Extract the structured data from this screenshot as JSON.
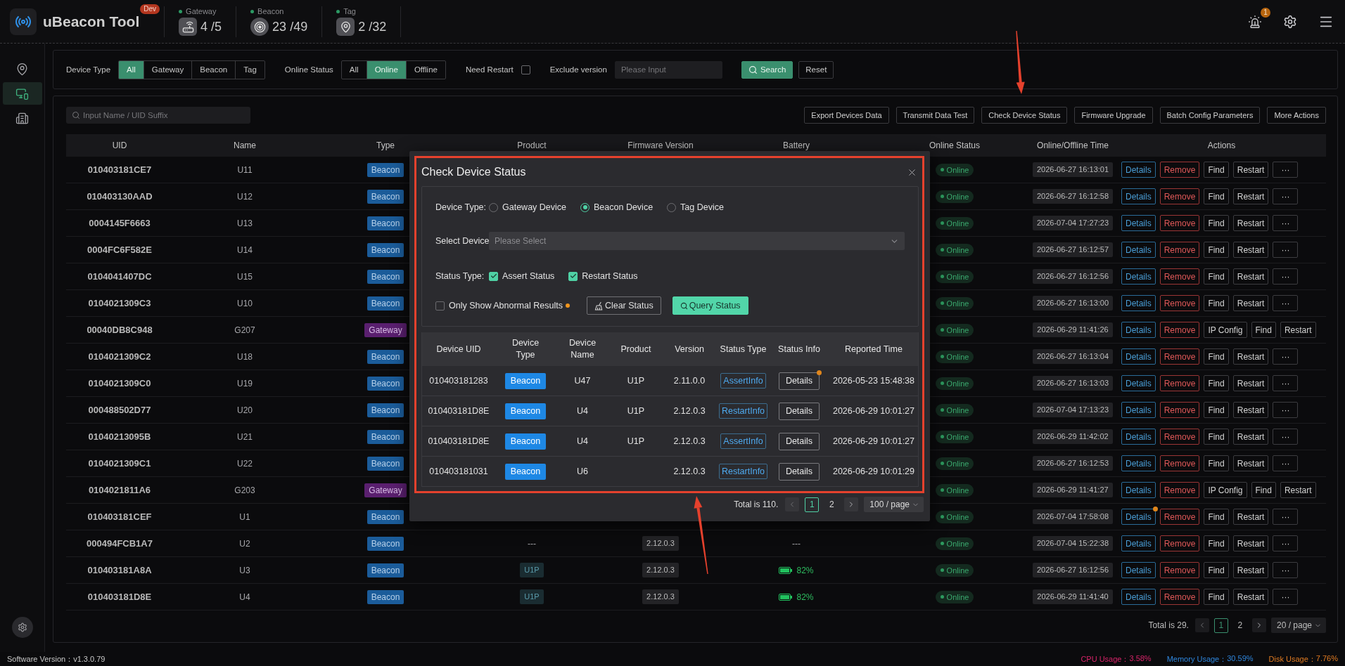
{
  "app": {
    "title": "uBeacon Tool",
    "badge": "Dev"
  },
  "stats": [
    {
      "kind": "gateway",
      "label": "Gateway",
      "value": "4 /5"
    },
    {
      "kind": "beacon",
      "label": "Beacon",
      "value": "23 /49"
    },
    {
      "kind": "tag",
      "label": "Tag",
      "value": "2 /32"
    }
  ],
  "notifications": {
    "count": "1"
  },
  "sidebar": {
    "items": [
      {
        "kind": "map",
        "selected": false
      },
      {
        "kind": "devices",
        "selected": true
      },
      {
        "kind": "building",
        "selected": false
      }
    ]
  },
  "filters": {
    "device_type": {
      "label": "Device Type",
      "options": [
        {
          "label": "All",
          "selected": true
        },
        {
          "label": "Gateway",
          "selected": false
        },
        {
          "label": "Beacon",
          "selected": false
        },
        {
          "label": "Tag",
          "selected": false
        }
      ]
    },
    "online_status": {
      "label": "Online Status",
      "options": [
        {
          "label": "All",
          "selected": false
        },
        {
          "label": "Online",
          "selected": true
        },
        {
          "label": "Offline",
          "selected": false
        }
      ]
    },
    "need_restart": {
      "label": "Need Restart",
      "checked": false
    },
    "exclude_version": {
      "label": "Exclude version",
      "placeholder": "Please Input"
    },
    "buttons": [
      {
        "label": "Search",
        "kind": "primary"
      },
      {
        "label": "Reset",
        "kind": "default"
      }
    ]
  },
  "device_list": {
    "search": {
      "placeholder": "Input Name / UID Suffix"
    },
    "toolbar": [
      "Export Devices Data",
      "Transmit Data Test",
      "Check Device Status",
      "Firmware Upgrade",
      "Batch Config Parameters",
      "More Actions"
    ],
    "table": {
      "columns": [
        "UID",
        "Name",
        "Type",
        "Product",
        "Firmware Version",
        "Battery",
        "Online Status",
        "Online/Offline Time",
        "Actions"
      ],
      "rows": [
        {
          "uid": "010403181CE7",
          "name": "U11",
          "type": {
            "label": "Beacon",
            "kind": "beacon"
          },
          "status": "Online",
          "time": "2026-06-27 16:13:01",
          "alert": false,
          "actions": [
            {
              "label": "Details",
              "kind": "info"
            },
            {
              "label": "Remove",
              "kind": "danger"
            },
            {
              "label": "Find",
              "kind": "default"
            },
            {
              "label": "Restart",
              "kind": "default"
            },
            {
              "label": "···",
              "kind": "more"
            }
          ]
        },
        {
          "uid": "010403130AAD",
          "name": "U12",
          "type": {
            "label": "Beacon",
            "kind": "beacon"
          },
          "status": "Online",
          "time": "2026-06-27 16:12:58",
          "alert": false,
          "actions": [
            {
              "label": "Details",
              "kind": "info"
            },
            {
              "label": "Remove",
              "kind": "danger"
            },
            {
              "label": "Find",
              "kind": "default"
            },
            {
              "label": "Restart",
              "kind": "default"
            },
            {
              "label": "···",
              "kind": "more"
            }
          ]
        },
        {
          "uid": "0004145F6663",
          "name": "U13",
          "type": {
            "label": "Beacon",
            "kind": "beacon"
          },
          "status": "Online",
          "time": "2026-07-04 17:27:23",
          "alert": false,
          "actions": [
            {
              "label": "Details",
              "kind": "info"
            },
            {
              "label": "Remove",
              "kind": "danger"
            },
            {
              "label": "Find",
              "kind": "default"
            },
            {
              "label": "Restart",
              "kind": "default"
            },
            {
              "label": "···",
              "kind": "more"
            }
          ]
        },
        {
          "uid": "0004FC6F582E",
          "name": "U14",
          "type": {
            "label": "Beacon",
            "kind": "beacon"
          },
          "status": "Online",
          "time": "2026-06-27 16:12:57",
          "alert": false,
          "actions": [
            {
              "label": "Details",
              "kind": "info"
            },
            {
              "label": "Remove",
              "kind": "danger"
            },
            {
              "label": "Find",
              "kind": "default"
            },
            {
              "label": "Restart",
              "kind": "default"
            },
            {
              "label": "···",
              "kind": "more"
            }
          ]
        },
        {
          "uid": "0104041407DC",
          "name": "U15",
          "type": {
            "label": "Beacon",
            "kind": "beacon"
          },
          "status": "Online",
          "time": "2026-06-27 16:12:56",
          "alert": false,
          "actions": [
            {
              "label": "Details",
              "kind": "info"
            },
            {
              "label": "Remove",
              "kind": "danger"
            },
            {
              "label": "Find",
              "kind": "default"
            },
            {
              "label": "Restart",
              "kind": "default"
            },
            {
              "label": "···",
              "kind": "more"
            }
          ]
        },
        {
          "uid": "0104021309C3",
          "name": "U10",
          "type": {
            "label": "Beacon",
            "kind": "beacon"
          },
          "status": "Online",
          "time": "2026-06-27 16:13:00",
          "alert": false,
          "actions": [
            {
              "label": "Details",
              "kind": "info"
            },
            {
              "label": "Remove",
              "kind": "danger"
            },
            {
              "label": "Find",
              "kind": "default"
            },
            {
              "label": "Restart",
              "kind": "default"
            },
            {
              "label": "···",
              "kind": "more"
            }
          ]
        },
        {
          "uid": "00040DB8C948",
          "name": "G207",
          "type": {
            "label": "Gateway",
            "kind": "gateway"
          },
          "status": "Online",
          "time": "2026-06-29 11:41:26",
          "alert": false,
          "actions": [
            {
              "label": "Details",
              "kind": "info"
            },
            {
              "label": "Remove",
              "kind": "danger"
            },
            {
              "label": "IP Config",
              "kind": "default"
            },
            {
              "label": "Find",
              "kind": "default"
            },
            {
              "label": "Restart",
              "kind": "default"
            }
          ]
        },
        {
          "uid": "0104021309C2",
          "name": "U18",
          "type": {
            "label": "Beacon",
            "kind": "beacon"
          },
          "status": "Online",
          "time": "2026-06-27 16:13:04",
          "alert": false,
          "actions": [
            {
              "label": "Details",
              "kind": "info"
            },
            {
              "label": "Remove",
              "kind": "danger"
            },
            {
              "label": "Find",
              "kind": "default"
            },
            {
              "label": "Restart",
              "kind": "default"
            },
            {
              "label": "···",
              "kind": "more"
            }
          ]
        },
        {
          "uid": "0104021309C0",
          "name": "U19",
          "type": {
            "label": "Beacon",
            "kind": "beacon"
          },
          "status": "Online",
          "time": "2026-06-27 16:13:03",
          "alert": false,
          "actions": [
            {
              "label": "Details",
              "kind": "info"
            },
            {
              "label": "Remove",
              "kind": "danger"
            },
            {
              "label": "Find",
              "kind": "default"
            },
            {
              "label": "Restart",
              "kind": "default"
            },
            {
              "label": "···",
              "kind": "more"
            }
          ]
        },
        {
          "uid": "000488502D77",
          "name": "U20",
          "type": {
            "label": "Beacon",
            "kind": "beacon"
          },
          "status": "Online",
          "time": "2026-07-04 17:13:23",
          "alert": false,
          "actions": [
            {
              "label": "Details",
              "kind": "info"
            },
            {
              "label": "Remove",
              "kind": "danger"
            },
            {
              "label": "Find",
              "kind": "default"
            },
            {
              "label": "Restart",
              "kind": "default"
            },
            {
              "label": "···",
              "kind": "more"
            }
          ]
        },
        {
          "uid": "01040213095B",
          "name": "U21",
          "type": {
            "label": "Beacon",
            "kind": "beacon"
          },
          "status": "Online",
          "time": "2026-06-29 11:42:02",
          "alert": false,
          "actions": [
            {
              "label": "Details",
              "kind": "info"
            },
            {
              "label": "Remove",
              "kind": "danger"
            },
            {
              "label": "Find",
              "kind": "default"
            },
            {
              "label": "Restart",
              "kind": "default"
            },
            {
              "label": "···",
              "kind": "more"
            }
          ]
        },
        {
          "uid": "0104021309C1",
          "name": "U22",
          "type": {
            "label": "Beacon",
            "kind": "beacon"
          },
          "status": "Online",
          "time": "2026-06-27 16:12:53",
          "alert": false,
          "actions": [
            {
              "label": "Details",
              "kind": "info"
            },
            {
              "label": "Remove",
              "kind": "danger"
            },
            {
              "label": "Find",
              "kind": "default"
            },
            {
              "label": "Restart",
              "kind": "default"
            },
            {
              "label": "···",
              "kind": "more"
            }
          ]
        },
        {
          "uid": "0104021811A6",
          "name": "G203",
          "type": {
            "label": "Gateway",
            "kind": "gateway"
          },
          "status": "Online",
          "time": "2026-06-29 11:41:27",
          "alert": false,
          "actions": [
            {
              "label": "Details",
              "kind": "info"
            },
            {
              "label": "Remove",
              "kind": "danger"
            },
            {
              "label": "IP Config",
              "kind": "default"
            },
            {
              "label": "Find",
              "kind": "default"
            },
            {
              "label": "Restart",
              "kind": "default"
            }
          ]
        },
        {
          "uid": "010403181CEF",
          "name": "U1",
          "type": {
            "label": "Beacon",
            "kind": "beacon"
          },
          "status": "Online",
          "time": "2026-07-04 17:58:08",
          "alert": true,
          "actions": [
            {
              "label": "Details",
              "kind": "info"
            },
            {
              "label": "Remove",
              "kind": "danger"
            },
            {
              "label": "Find",
              "kind": "default"
            },
            {
              "label": "Restart",
              "kind": "default"
            },
            {
              "label": "···",
              "kind": "more"
            }
          ]
        },
        {
          "uid": "000494FCB1A7",
          "name": "U2",
          "type": {
            "label": "Beacon",
            "kind": "beacon"
          },
          "product": {
            "text": "---",
            "kind": "plain"
          },
          "firmware": "2.12.0.3",
          "battery": {
            "text": "---",
            "kind": "plain"
          },
          "status": "Online",
          "time": "2026-07-04 15:22:38",
          "alert": false,
          "actions": [
            {
              "label": "Details",
              "kind": "info"
            },
            {
              "label": "Remove",
              "kind": "danger"
            },
            {
              "label": "Find",
              "kind": "default"
            },
            {
              "label": "Restart",
              "kind": "default"
            },
            {
              "label": "···",
              "kind": "more"
            }
          ]
        },
        {
          "uid": "010403181A8A",
          "name": "U3",
          "type": {
            "label": "Beacon",
            "kind": "beacon"
          },
          "product": {
            "text": "U1P",
            "kind": "tag"
          },
          "firmware": "2.12.0.3",
          "battery": {
            "text": "82%",
            "kind": "level"
          },
          "status": "Online",
          "time": "2026-06-27 16:12:56",
          "alert": false,
          "actions": [
            {
              "label": "Details",
              "kind": "info"
            },
            {
              "label": "Remove",
              "kind": "danger"
            },
            {
              "label": "Find",
              "kind": "default"
            },
            {
              "label": "Restart",
              "kind": "default"
            },
            {
              "label": "···",
              "kind": "more"
            }
          ]
        },
        {
          "uid": "010403181D8E",
          "name": "U4",
          "type": {
            "label": "Beacon",
            "kind": "beacon"
          },
          "product": {
            "text": "U1P",
            "kind": "tag"
          },
          "firmware": "2.12.0.3",
          "battery": {
            "text": "82%",
            "kind": "level"
          },
          "status": "Online",
          "time": "2026-06-29 11:41:40",
          "alert": false,
          "actions": [
            {
              "label": "Details",
              "kind": "info"
            },
            {
              "label": "Remove",
              "kind": "danger"
            },
            {
              "label": "Find",
              "kind": "default"
            },
            {
              "label": "Restart",
              "kind": "default"
            },
            {
              "label": "···",
              "kind": "more"
            }
          ]
        }
      ]
    },
    "pagination": {
      "total": "Total is 29.",
      "pages": [
        {
          "label": "1",
          "selected": true
        },
        {
          "label": "2",
          "selected": false
        }
      ],
      "page_size": "20 / page"
    }
  },
  "modal": {
    "title": "Check Device Status",
    "device_type": {
      "label": "Device Type:",
      "options": [
        {
          "label": "Gateway Device",
          "selected": false
        },
        {
          "label": "Beacon Device",
          "selected": true
        },
        {
          "label": "Tag Device",
          "selected": false
        }
      ]
    },
    "select_device": {
      "label": "Select Device",
      "placeholder": "Please Select"
    },
    "status_type": {
      "label": "Status Type:",
      "options": [
        {
          "label": "Assert Status",
          "checked": true
        },
        {
          "label": "Restart Status",
          "checked": true
        }
      ]
    },
    "abnormal_only": {
      "label": "Only Show Abnormal Results",
      "checked": false
    },
    "buttons": [
      {
        "label": "Clear Status",
        "kind": "clear"
      },
      {
        "label": "Query Status",
        "kind": "query"
      }
    ],
    "table": {
      "columns": [
        "Device UID",
        "Device Type",
        "Device Name",
        "Product",
        "Version",
        "Status Type",
        "Status Info",
        "Reported Time"
      ],
      "rows": [
        {
          "uid": "010403181283",
          "type": "Beacon",
          "name": "U47",
          "product": "U1P",
          "version": "2.11.0.0",
          "status_type": "AssertInfo",
          "info": "Details",
          "time": "2026-05-23 15:48:38",
          "alert": true
        },
        {
          "uid": "010403181D8E",
          "type": "Beacon",
          "name": "U4",
          "product": "U1P",
          "version": "2.12.0.3",
          "status_type": "RestartInfo",
          "info": "Details",
          "time": "2026-06-29 10:01:27",
          "alert": false
        },
        {
          "uid": "010403181D8E",
          "type": "Beacon",
          "name": "U4",
          "product": "U1P",
          "version": "2.12.0.3",
          "status_type": "AssertInfo",
          "info": "Details",
          "time": "2026-06-29 10:01:27",
          "alert": false
        },
        {
          "uid": "010403181031",
          "type": "Beacon",
          "name": "U6",
          "version": "2.12.0.3",
          "status_type": "RestartInfo",
          "info": "Details",
          "time": "2026-06-29 10:01:29",
          "alert": false
        }
      ]
    },
    "pagination": {
      "total": "Total is 110.",
      "pages": [
        {
          "label": "1",
          "selected": true
        },
        {
          "label": "2",
          "selected": false
        }
      ],
      "page_size": "100 / page"
    }
  },
  "status_bar": {
    "version": "Software Version：v1.3.0.79",
    "usage": [
      {
        "label": "CPU Usage：",
        "value": "3.58%",
        "color": "#d8246a"
      },
      {
        "label": "Memory Usage：",
        "value": "30.59%",
        "color": "#2f86dc"
      },
      {
        "label": "Disk Usage：",
        "value": "7.76%",
        "color": "#e07b22"
      }
    ]
  }
}
